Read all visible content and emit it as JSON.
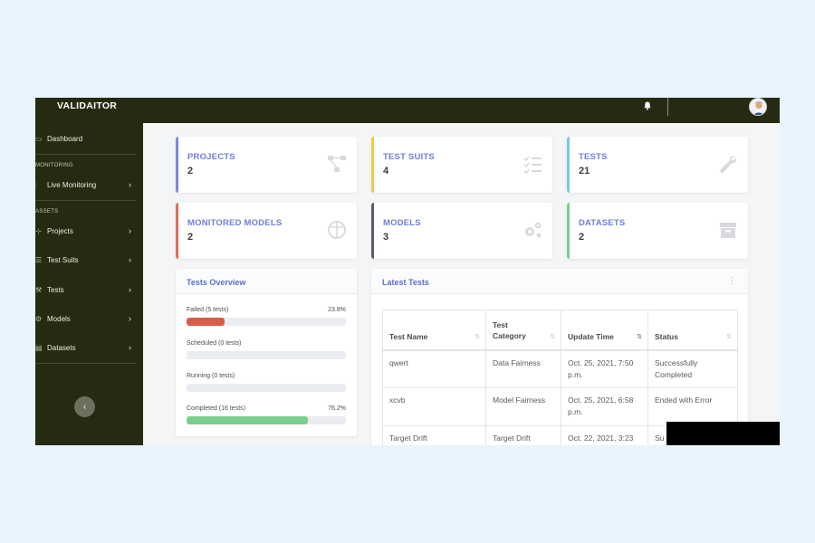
{
  "app": {
    "brand": "VALIDAITOR"
  },
  "sidebar": {
    "dashboard": {
      "label": "Dashboard",
      "icon": "monitor-icon"
    },
    "sections": [
      {
        "heading": "MONITORING",
        "items": [
          {
            "label": "Live Monitoring",
            "icon": "chart-icon"
          }
        ]
      },
      {
        "heading": "ASSETS",
        "items": [
          {
            "label": "Projects",
            "icon": "diagram-icon"
          },
          {
            "label": "Test Suits",
            "icon": "list-icon"
          },
          {
            "label": "Tests",
            "icon": "wrench-icon"
          },
          {
            "label": "Models",
            "icon": "cogs-icon"
          },
          {
            "label": "Datasets",
            "icon": "archive-icon"
          }
        ]
      }
    ],
    "collapse": "‹"
  },
  "stats": [
    {
      "title": "PROJECTS",
      "value": "2",
      "color": "#7a8ae0",
      "icon": "diagram-icon"
    },
    {
      "title": "TEST SUITS",
      "value": "4",
      "color": "#f2c94c",
      "icon": "list-check-icon"
    },
    {
      "title": "TESTS",
      "value": "21",
      "color": "#7bc6e0",
      "icon": "wrench-icon"
    },
    {
      "title": "MONITORED MODELS",
      "value": "2",
      "color": "#e0705d",
      "icon": "radar-icon"
    },
    {
      "title": "MODELS",
      "value": "3",
      "color": "#5b5e66",
      "icon": "cogs-icon"
    },
    {
      "title": "DATASETS",
      "value": "2",
      "color": "#7bcf8e",
      "icon": "archive-icon"
    }
  ],
  "overview": {
    "title": "Tests Overview",
    "bars": [
      {
        "label": "Failed (5 tests)",
        "value": "23.8%",
        "fraction": 0.238,
        "color": "#d85c4a"
      },
      {
        "label": "Scheduled (0 tests)",
        "value": "",
        "fraction": 0,
        "color": "#cfd3e6"
      },
      {
        "label": "Running (0 tests)",
        "value": "",
        "fraction": 0,
        "color": "#cfd3e6"
      },
      {
        "label": "Completed (16 tests)",
        "value": "76.2%",
        "fraction": 0.762,
        "color": "#7bcf8e"
      }
    ]
  },
  "latest": {
    "title": "Latest Tests",
    "menu": "⋮",
    "columns": [
      "Test Name",
      "Test Category",
      "Update Time",
      "Status"
    ],
    "rows": [
      [
        "qwert",
        "Data Fairness",
        "Oct. 25, 2021, 7:50 p.m.",
        "Successfully Completed"
      ],
      [
        "xcvb",
        "Model Fairness",
        "Oct. 25, 2021, 6:58 p.m.",
        "Ended with Error"
      ],
      [
        "Target Drift",
        "Target Drift",
        "Oct. 22, 2021, 3:23",
        "Su"
      ]
    ]
  }
}
